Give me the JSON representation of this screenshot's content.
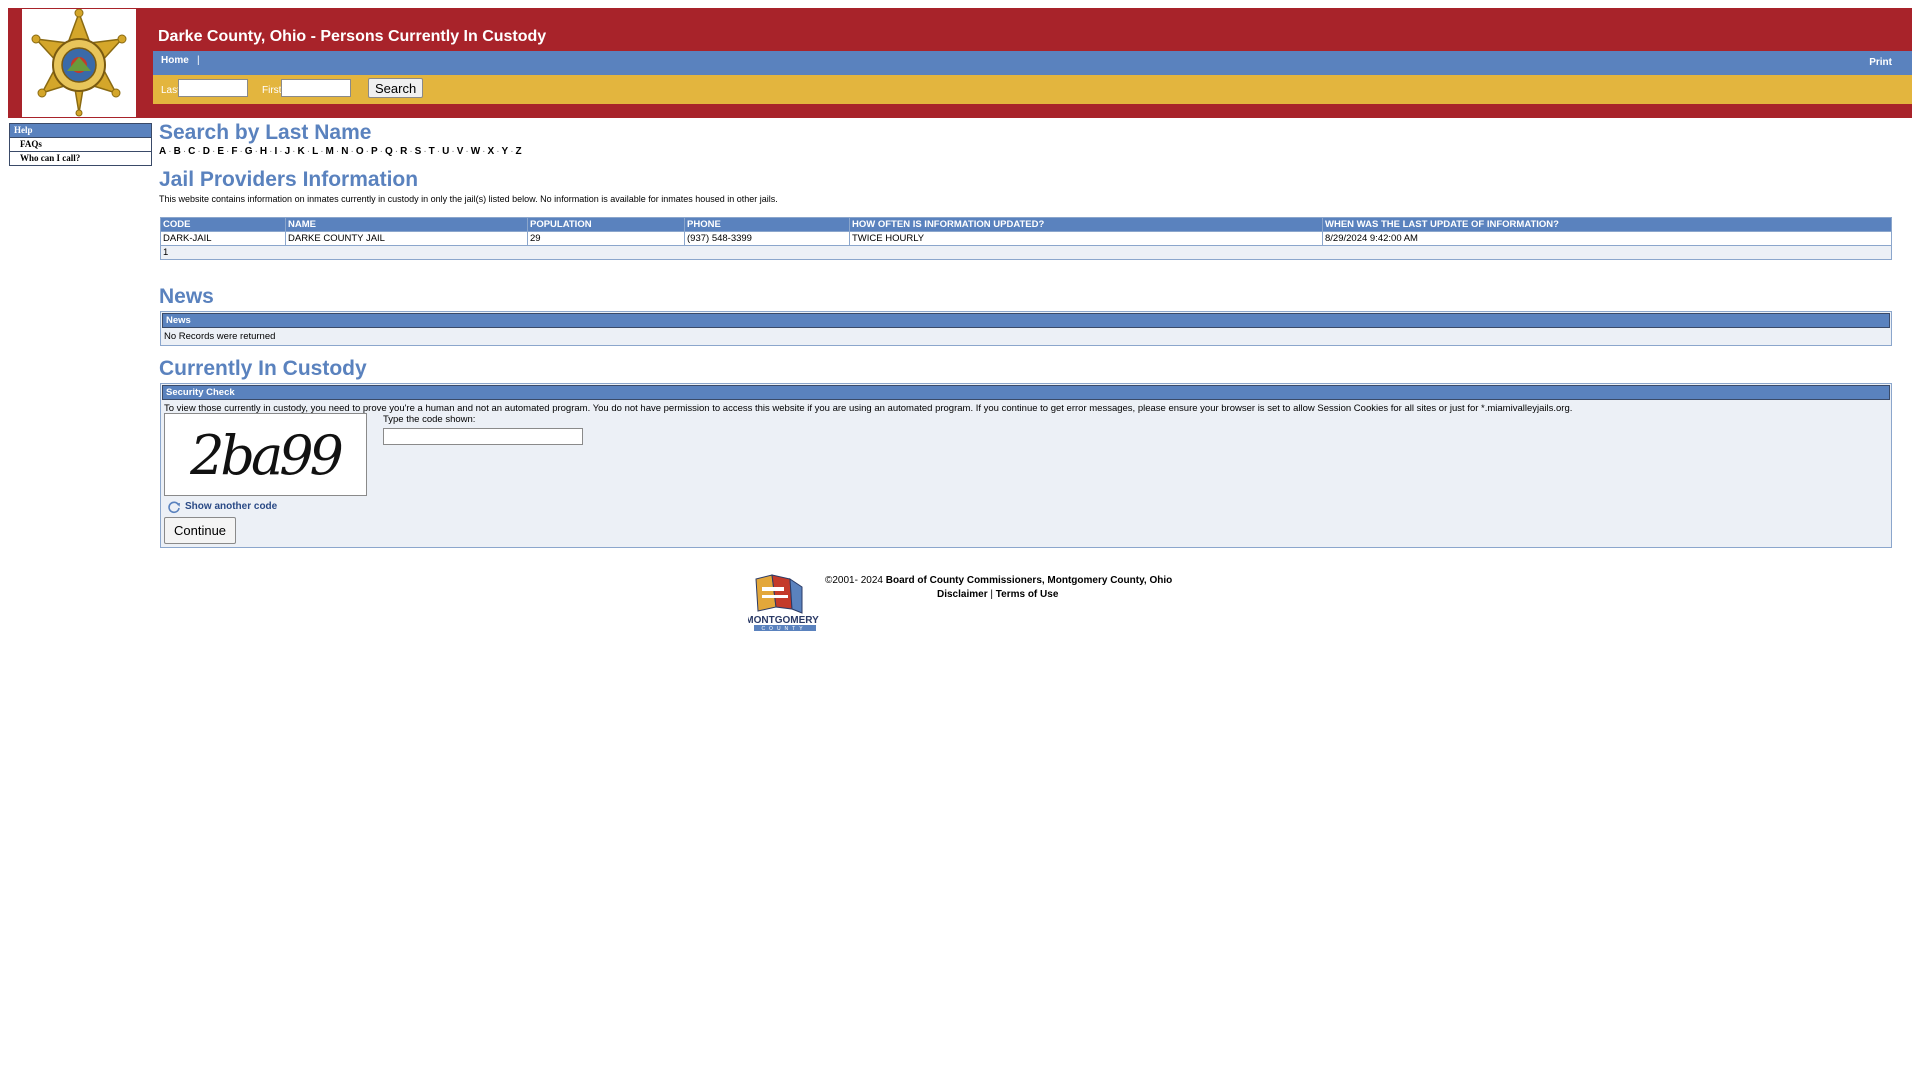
{
  "header": {
    "title": "Darke County, Ohio - Persons Currently In Custody",
    "nav_home": "Home",
    "nav_sep": "|",
    "nav_print": "Print",
    "logo_icon": "sheriff-star-badge"
  },
  "search": {
    "last_label": "Last",
    "last_value": "",
    "first_label": "First",
    "first_value": "",
    "button": "Search"
  },
  "sidebar": {
    "help": "Help",
    "items": [
      "FAQs",
      "Who can I call?"
    ]
  },
  "main": {
    "search_heading": "Search by Last Name",
    "letters": [
      "A",
      "B",
      "C",
      "D",
      "E",
      "F",
      "G",
      "H",
      "I",
      "J",
      "K",
      "L",
      "M",
      "N",
      "O",
      "P",
      "Q",
      "R",
      "S",
      "T",
      "U",
      "V",
      "W",
      "X",
      "Y",
      "Z"
    ],
    "providers_heading": "Jail Providers Information",
    "providers_note": "This website contains information on inmates currently in custody in only the jail(s) listed below. No information is available for inmates housed in other jails.",
    "providers_table": {
      "headers": [
        "CODE",
        "NAME",
        "POPULATION",
        "PHONE",
        "HOW OFTEN IS INFORMATION UPDATED?",
        "WHEN WAS THE LAST UPDATE OF INFORMATION?"
      ],
      "rows": [
        [
          "DARK-JAIL",
          "DARKE COUNTY JAIL",
          "29",
          "(937) 548-3399",
          "TWICE HOURLY",
          "8/29/2024 9:42:00 AM"
        ]
      ],
      "pager": "1"
    },
    "news_heading": "News",
    "news_table_header": "News",
    "news_empty": "No Records were returned",
    "custody_heading": "Currently In Custody",
    "security": {
      "header": "Security Check",
      "text": "To view those currently in custody, you need to prove you're a human and not an automated program. You do not have permission to access this website if you are using an automated program. If you continue to get error messages, please ensure your browser is set to allow Session Cookies for all sites or just for *.miamivalleyjails.org.",
      "captcha_code": "2ba99",
      "code_label": "Type the code shown:",
      "code_value": "",
      "show_another": "Show another code",
      "continue": "Continue"
    }
  },
  "footer": {
    "copyright_prefix": "©2001- 2024",
    "copyright_org": "Board of County Commissioners, Montgomery County, Ohio",
    "disclaimer": "Disclaimer",
    "link_sep": "|",
    "terms": "Terms of Use",
    "logo_text": "MONTGOMERY",
    "logo_subtext": "COUNTY"
  },
  "colors": {
    "header_red": "#a8232a",
    "nav_blue": "#5a82be",
    "search_gold": "#e3b53e",
    "heading_blue": "#5a82be"
  }
}
